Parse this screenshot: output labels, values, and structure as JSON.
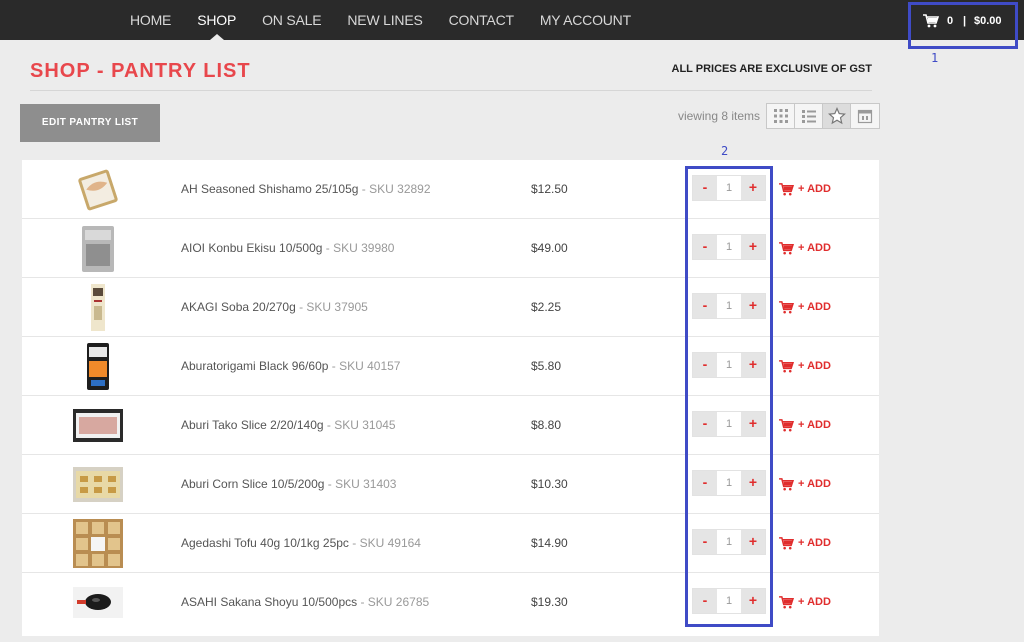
{
  "nav": {
    "items": [
      {
        "label": "HOME"
      },
      {
        "label": "SHOP"
      },
      {
        "label": "ON SALE"
      },
      {
        "label": "NEW LINES"
      },
      {
        "label": "CONTACT"
      },
      {
        "label": "MY ACCOUNT"
      }
    ],
    "active": "SHOP"
  },
  "cart": {
    "count": "0",
    "separator": "|",
    "total": "$0.00",
    "icon": "cart-icon"
  },
  "annotations": {
    "cart": "1",
    "quantity": "2"
  },
  "page": {
    "title": "SHOP - PANTRY LIST",
    "gst_note": "ALL PRICES ARE EXCLUSIVE OF GST"
  },
  "toolbar": {
    "edit_label": "EDIT PANTRY LIST",
    "viewing_text": "viewing 8 items",
    "view_options": [
      "grid-icon",
      "list-icon",
      "star-icon",
      "calendar-icon"
    ],
    "active_view": "star-icon"
  },
  "products": [
    {
      "name": "AH Seasoned Shishamo 25/105g",
      "sku": " - SKU 32892",
      "price": "$12.50",
      "qty": "1"
    },
    {
      "name": "AIOI Konbu Ekisu 10/500g",
      "sku": " - SKU 39980",
      "price": "$49.00",
      "qty": "1"
    },
    {
      "name": "AKAGI Soba 20/270g",
      "sku": " - SKU 37905",
      "price": "$2.25",
      "qty": "1"
    },
    {
      "name": "Aburatorigami Black 96/60p",
      "sku": " - SKU 40157",
      "price": "$5.80",
      "qty": "1"
    },
    {
      "name": "Aburi Tako Slice 2/20/140g",
      "sku": " - SKU 31045",
      "price": "$8.80",
      "qty": "1"
    },
    {
      "name": "Aburi Corn Slice 10/5/200g",
      "sku": " - SKU 31403",
      "price": "$10.30",
      "qty": "1"
    },
    {
      "name": "Agedashi Tofu 40g 10/1kg 25pc",
      "sku": " - SKU 49164",
      "price": "$14.90",
      "qty": "1"
    },
    {
      "name": "ASAHI Sakana Shoyu 10/500pcs",
      "sku": " - SKU 26785",
      "price": "$19.30",
      "qty": "1"
    }
  ],
  "row_controls": {
    "minus": "-",
    "plus": "+",
    "add_label": "+ ADD"
  },
  "colors": {
    "accent": "#e8474c",
    "annotation": "#3f4bc6",
    "nav_bg": "#2a2a2a"
  }
}
